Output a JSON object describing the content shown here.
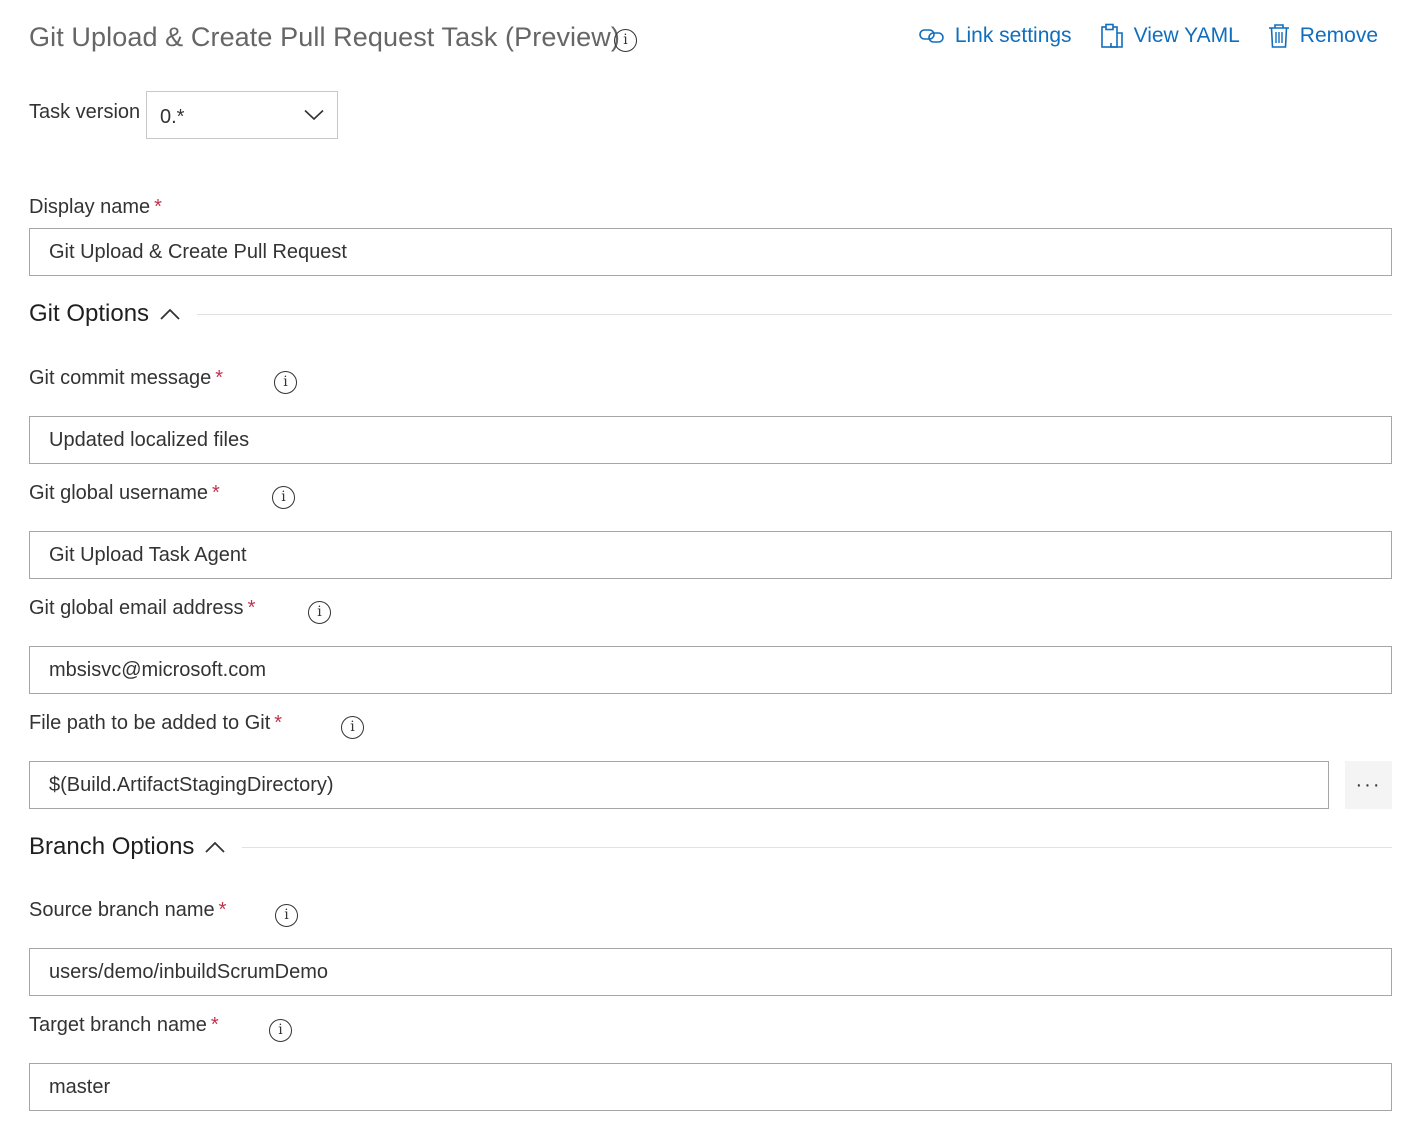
{
  "header": {
    "title": "Git Upload & Create Pull Request Task (Preview)",
    "actions": {
      "link_settings": "Link settings",
      "view_yaml": "View YAML",
      "remove": "Remove"
    }
  },
  "task_version": {
    "label": "Task version",
    "value": "0.*"
  },
  "display_name": {
    "label": "Display name",
    "required_mark": "*",
    "value": "Git Upload & Create Pull Request"
  },
  "git_options": {
    "title": "Git Options",
    "fields": {
      "commit_message": {
        "label": "Git commit message",
        "required_mark": "*",
        "value": "Updated localized files"
      },
      "username": {
        "label": "Git global username",
        "required_mark": "*",
        "value": "Git Upload Task Agent"
      },
      "email": {
        "label": "Git global email address",
        "required_mark": "*",
        "value": "mbsisvc@microsoft.com"
      },
      "file_path": {
        "label": "File path to be added to Git",
        "required_mark": "*",
        "value": "$(Build.ArtifactStagingDirectory)",
        "browse_label": "···"
      }
    }
  },
  "branch_options": {
    "title": "Branch Options",
    "fields": {
      "source_branch": {
        "label": "Source branch name",
        "required_mark": "*",
        "value": "users/demo/inbuildScrumDemo"
      },
      "target_branch": {
        "label": "Target branch name",
        "required_mark": "*",
        "value": "master"
      }
    }
  },
  "colors": {
    "accent": "#106ebe",
    "required": "#c4314b",
    "border": "#a6a6a6"
  },
  "icons": [
    "info-icon",
    "link-icon",
    "clipboard-icon",
    "trash-icon",
    "chevron-down-icon",
    "chevron-up-icon"
  ]
}
